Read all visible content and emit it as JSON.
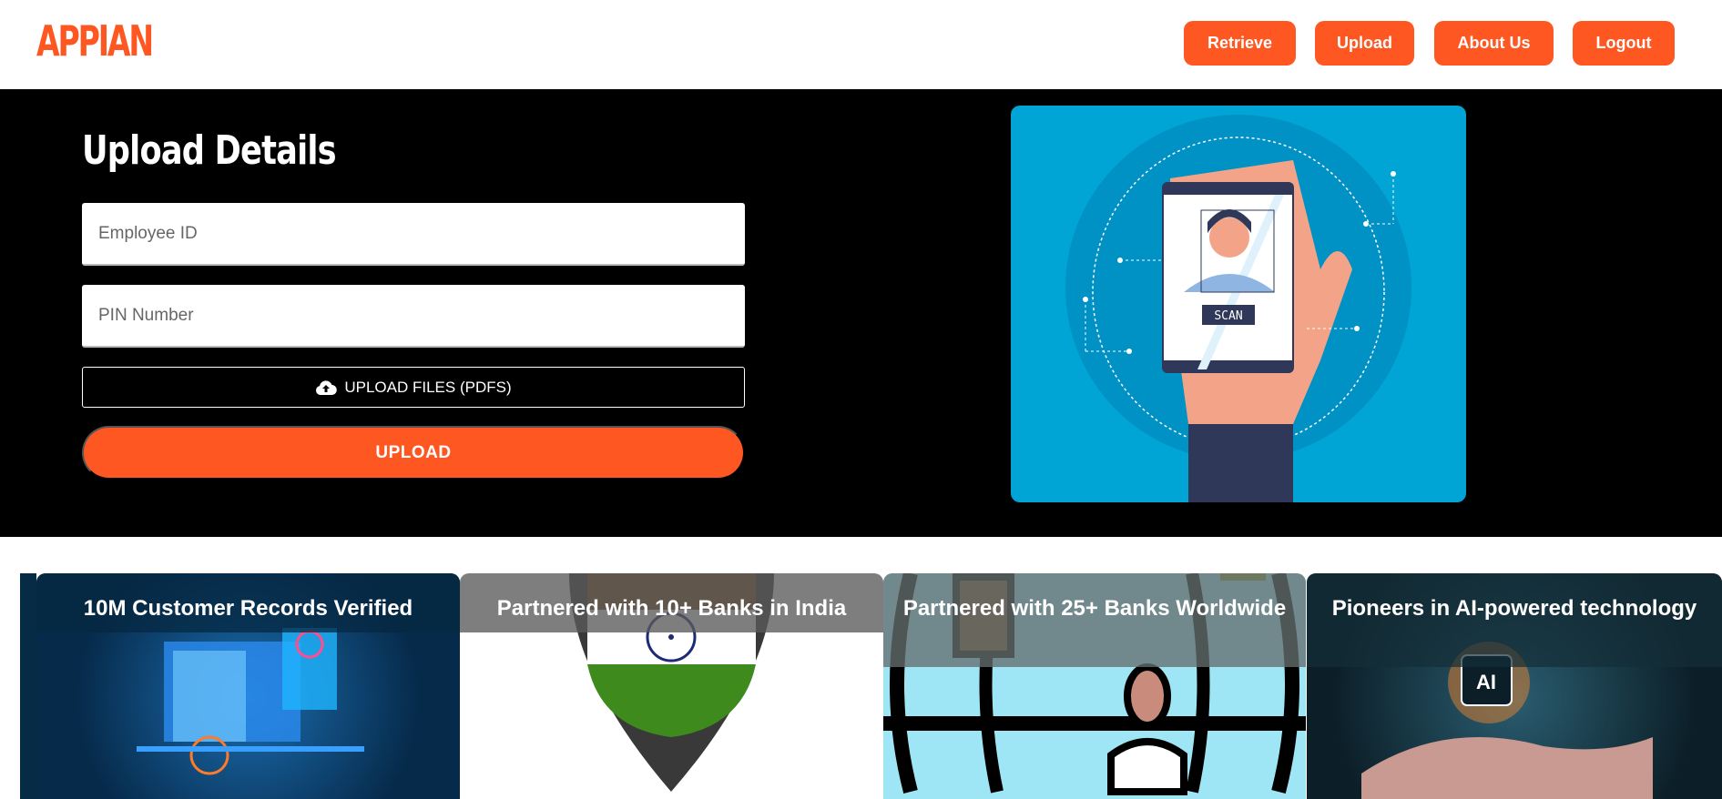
{
  "header": {
    "logo": "APPIAN",
    "nav": [
      "Retrieve",
      "Upload",
      "About Us",
      "Logout"
    ]
  },
  "hero": {
    "title": "Upload Details",
    "employee_placeholder": "Employee ID",
    "pin_placeholder": "PIN Number",
    "files_label": "UPLOAD FILES (PDFS)",
    "upload_label": "UPLOAD",
    "illustration_text": "SCAN"
  },
  "cards": [
    {
      "title": "10M Customer Records Verified"
    },
    {
      "title": "Partnered with 10+ Banks in India"
    },
    {
      "title": "Partnered with 25+ Banks Worldwide"
    },
    {
      "title": "Pioneers in AI-powered technology"
    }
  ],
  "colors": {
    "accent": "#ff5722",
    "hero_bg": "#000000",
    "illustration_bg": "#00a5d6"
  }
}
